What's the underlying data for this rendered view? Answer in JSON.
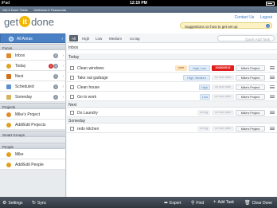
{
  "status": {
    "carrier": "iPad",
    "time": "12:19 PM"
  },
  "app_nav": {
    "left": "Get It Done Tasks",
    "middle": "Getitdone.it Passwords"
  },
  "header": {
    "logo_left": "get",
    "logo_it": "it",
    "logo_right": "done",
    "contact": "Contact Us",
    "logout": "Logout",
    "suggestion": "Suggestions on how to get set up"
  },
  "sidebar": {
    "all_areas": "All Areas",
    "focus_label": "Focus",
    "focus": [
      {
        "label": "Inbox",
        "count": "5",
        "color": "#e08a2a"
      },
      {
        "label": "Today",
        "count": "4",
        "alert": "1",
        "color": "#e0a020"
      },
      {
        "label": "Next",
        "count": "1",
        "color": "#d06f1a"
      },
      {
        "label": "Scheduled",
        "count": "1",
        "color": "#5c8fd0"
      },
      {
        "label": "Someday",
        "count": "1",
        "color": "#d7b25a"
      }
    ],
    "projects_label": "Projects",
    "projects": [
      {
        "label": "Mike's Project"
      },
      {
        "label": "Add/Edit Projects"
      }
    ],
    "smart_groups_label": "Smart Groups",
    "people_label": "People",
    "people": [
      {
        "label": "Mike"
      },
      {
        "label": "Add/Edit People"
      }
    ]
  },
  "filters": {
    "items": [
      "All",
      "High",
      "Low",
      "Medium",
      "no tag"
    ],
    "quick_add_placeholder": "Quick Add Task"
  },
  "groups": {
    "inbox": "Inbox",
    "today": "Today",
    "next": "Next",
    "someday": "Someday"
  },
  "tasks": [
    {
      "title": "Clean windows",
      "note": "note",
      "tag": "High, Low",
      "date": "10/26/2012",
      "project": "Mike's Project"
    },
    {
      "title": "Take out garbage",
      "tag": "High, Medium",
      "date": "no due date",
      "project": "Mike's Project"
    },
    {
      "title": "Clean house",
      "tag": "High",
      "date": "no due date",
      "project": "Mike's Project"
    },
    {
      "title": "Go to work",
      "tag": "Low",
      "date": "no due date",
      "project": "Mike's Project"
    },
    {
      "title": "Do Laundry",
      "tag": "no tag",
      "date": "no due date",
      "project": "Mike's Project"
    },
    {
      "title": "redo kitchen",
      "tag": "no tag",
      "date": "no due date",
      "project": "Mike's Project"
    }
  ],
  "bottombar": {
    "settings": "Settings",
    "sync": "Sync",
    "export": "Export",
    "find": "Find",
    "add_task": "Add Task",
    "clear_done": "Clear Done"
  },
  "colors": {
    "accent": "#4a81c4",
    "date_alert": "#e11d1d",
    "toolbar": "#3a424b"
  }
}
